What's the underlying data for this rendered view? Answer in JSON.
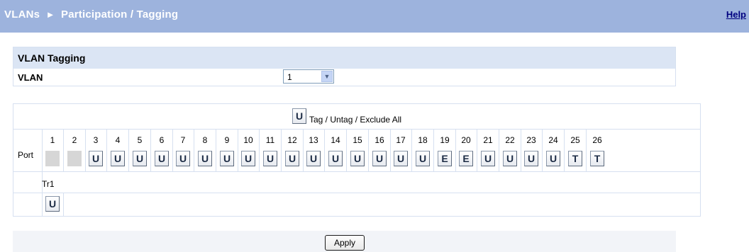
{
  "header": {
    "title_part1": "VLANs",
    "arrow": "►",
    "title_part2": "Participation / Tagging",
    "help": "Help"
  },
  "vlan_section": {
    "title": "VLAN Tagging",
    "vlan_label": "VLAN",
    "selected_vlan": "1"
  },
  "ports": {
    "all_button": "U",
    "all_label": "Tag / Untag / Exclude All",
    "port_label": "Port",
    "items": [
      {
        "num": "1",
        "state": ""
      },
      {
        "num": "2",
        "state": ""
      },
      {
        "num": "3",
        "state": "U"
      },
      {
        "num": "4",
        "state": "U"
      },
      {
        "num": "5",
        "state": "U"
      },
      {
        "num": "6",
        "state": "U"
      },
      {
        "num": "7",
        "state": "U"
      },
      {
        "num": "8",
        "state": "U"
      },
      {
        "num": "9",
        "state": "U"
      },
      {
        "num": "10",
        "state": "U"
      },
      {
        "num": "11",
        "state": "U"
      },
      {
        "num": "12",
        "state": "U"
      },
      {
        "num": "13",
        "state": "U"
      },
      {
        "num": "14",
        "state": "U"
      },
      {
        "num": "15",
        "state": "U"
      },
      {
        "num": "16",
        "state": "U"
      },
      {
        "num": "17",
        "state": "U"
      },
      {
        "num": "18",
        "state": "U"
      },
      {
        "num": "19",
        "state": "E"
      },
      {
        "num": "20",
        "state": "E"
      },
      {
        "num": "21",
        "state": "U"
      },
      {
        "num": "22",
        "state": "U"
      },
      {
        "num": "23",
        "state": "U"
      },
      {
        "num": "24",
        "state": "U"
      },
      {
        "num": "25",
        "state": "T"
      },
      {
        "num": "26",
        "state": "T"
      }
    ],
    "trunk": {
      "label": "Tr1",
      "state": "U"
    }
  },
  "apply": "Apply",
  "colors": {
    "header_bg": "#9db3dd",
    "section_bg": "#dbe5f4",
    "help_link": "#000080"
  }
}
